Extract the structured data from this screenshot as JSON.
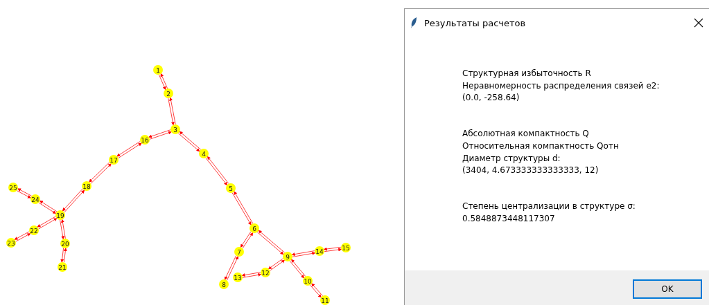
{
  "graph": {
    "nodes": [
      {
        "label": "1"
      },
      {
        "label": "2"
      },
      {
        "label": "3"
      },
      {
        "label": "4"
      },
      {
        "label": "5"
      },
      {
        "label": "6"
      },
      {
        "label": "7"
      },
      {
        "label": "8"
      },
      {
        "label": "9"
      },
      {
        "label": "10"
      },
      {
        "label": "11"
      },
      {
        "label": "12"
      },
      {
        "label": "13"
      },
      {
        "label": "14"
      },
      {
        "label": "15"
      },
      {
        "label": "16"
      },
      {
        "label": "17"
      },
      {
        "label": "18"
      },
      {
        "label": "19"
      },
      {
        "label": "20"
      },
      {
        "label": "21"
      },
      {
        "label": "22"
      },
      {
        "label": "23"
      },
      {
        "label": "24"
      },
      {
        "label": "25"
      }
    ]
  },
  "dialog": {
    "title": "Результаты расчетов",
    "blocks": [
      [
        "Структурная избыточность R",
        "Неравномерность распределения связей e2:",
        "(0.0, -258.64)"
      ],
      [
        "Абсолютная компактность Q",
        "Относительная компактность Qотн",
        "Диаметр структуры d:",
        "(3404, 4.673333333333333, 12)"
      ],
      [
        "Степень централизации в структуре σ:",
        "0.5848873448117307"
      ]
    ],
    "button": "OK"
  }
}
